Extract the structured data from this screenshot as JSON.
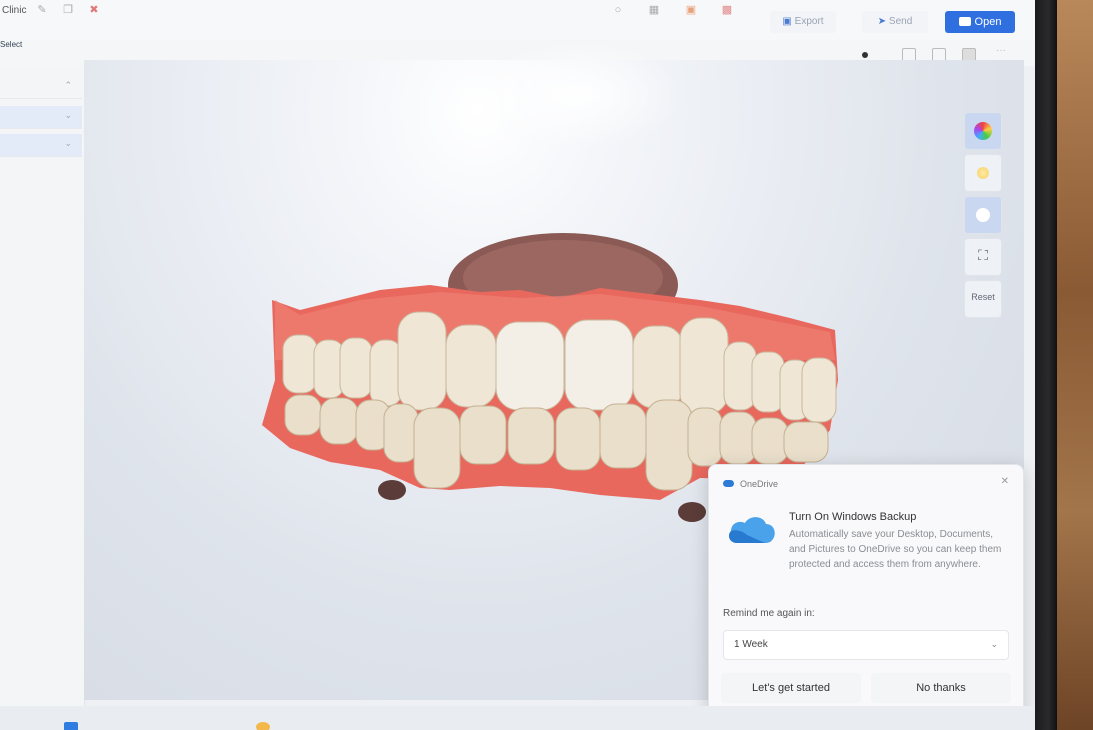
{
  "window": {
    "title": "Clinic"
  },
  "header_buttons": {
    "export": "Export",
    "send": "Send",
    "open": "Open"
  },
  "toolbar": {
    "tab": "Select"
  },
  "viewport": {
    "side_tools": [
      "color-texture",
      "lighting",
      "shading",
      "fit-view",
      "reset-view"
    ],
    "reset_label": "Reset"
  },
  "notification": {
    "app_name": "OneDrive",
    "title": "Turn On Windows Backup",
    "body": "Automatically save your Desktop, Documents, and Pictures to OneDrive so you can keep them protected and access them from anywhere.",
    "remind_label": "Remind me again in:",
    "remind_value": "1 Week",
    "primary_button": "Let's get started",
    "secondary_button": "No thanks",
    "close_glyph": "✕"
  },
  "colors": {
    "accent": "#2f6fe0",
    "gum": "#e8685e",
    "tooth": "#efe6d6"
  }
}
